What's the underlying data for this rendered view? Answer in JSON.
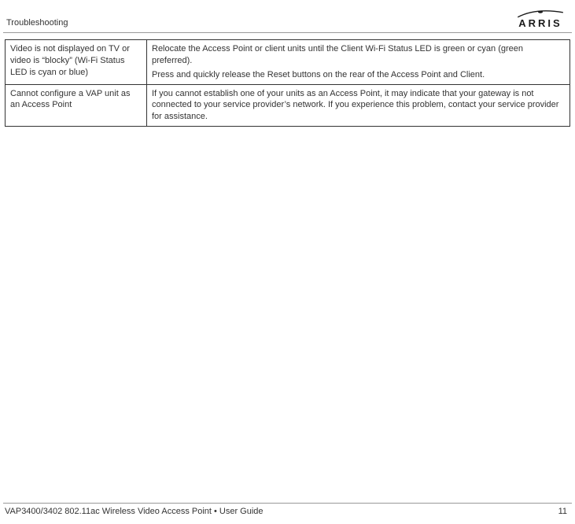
{
  "header": {
    "section_title": "Troubleshooting",
    "logo_text": "ARRIS"
  },
  "table": {
    "rows": [
      {
        "problem": "Video is not displayed on TV or video is “blocky” (Wi-Fi Status LED is cyan or blue)",
        "solution_parts": [
          "Relocate the Access Point or client units until the Client Wi-Fi Status LED is green or cyan (green preferred).",
          "Press and quickly release the Reset buttons on the rear of the Access Point and Client."
        ]
      },
      {
        "problem": "Cannot configure a VAP unit as an Access Point",
        "solution_parts": [
          "If you cannot establish one of your units as an Access Point, it may indicate that your gateway is not connected to your service provider’s network. If you experience this problem, contact your service provider for assistance."
        ]
      }
    ]
  },
  "footer": {
    "guide_title": "VAP3400/3402 802.11ac Wireless Video Access Point • User Guide",
    "page_number": "11"
  }
}
